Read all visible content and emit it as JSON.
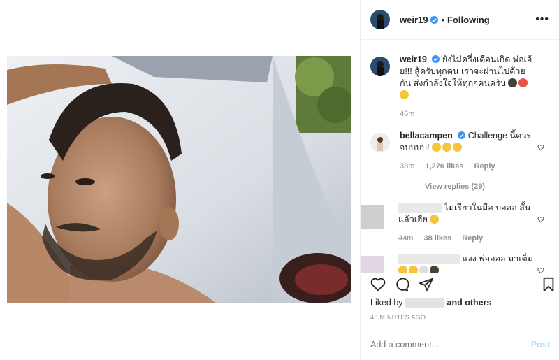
{
  "post": {
    "photo_alt": "selfie"
  },
  "header": {
    "username": "weir19",
    "separator": "•",
    "follow_label": "Following",
    "more_label": "•••"
  },
  "caption": {
    "username": "weir19",
    "text": "ยังไม่ครึ่งเดือนเกิด พ่อเอ้ย!!! สู้ครับทุกคน เราจะผ่านไปด้วยกัน ส่งกำลังใจให้ทุกๆคนครับ",
    "time": "46m"
  },
  "comments": [
    {
      "username": "bellacampen",
      "text": "Challenge นี้ควรจบบบบ!",
      "time": "33m",
      "likes": "1,276 likes",
      "reply": "Reply",
      "view_replies": "View replies (29)"
    },
    {
      "text": "ไม่เรียวในมือ บอลอ สั้นแล้วเฮีย",
      "time": "44m",
      "likes": "38 likes",
      "reply": "Reply"
    },
    {
      "text": "แงง พ่ออออ มาเต็ม"
    }
  ],
  "likes_line": {
    "prefix": "Liked by",
    "suffix": "and others"
  },
  "timestamp": "46 MINUTES AGO",
  "add_comment": {
    "placeholder": "Add a comment...",
    "post_label": "Post"
  },
  "colors": {
    "verified": "#3897f0",
    "muted": "#8e8e8e",
    "post_disabled": "#b2dffc",
    "border": "#efefef"
  }
}
